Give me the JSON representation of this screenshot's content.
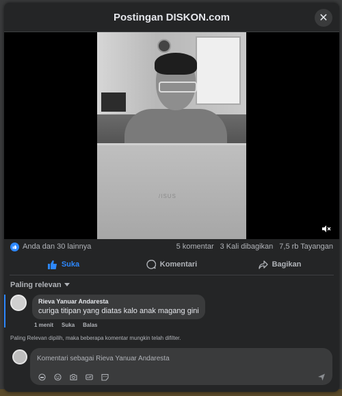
{
  "dialog": {
    "title": "Postingan DISKON.com",
    "close_symbol": "✕"
  },
  "video": {
    "laptop_logo": "/ISUS",
    "mute_icon": "volume-muted-icon"
  },
  "stats": {
    "reactions": "Anda dan 30 lainnya",
    "comments": "5 komentar",
    "shares": "3 Kali dibagikan",
    "views": "7,5 rb Tayangan"
  },
  "actions": {
    "like": "Suka",
    "comment": "Komentari",
    "share": "Bagikan"
  },
  "sort": {
    "label": "Paling relevan"
  },
  "comments": [
    {
      "author": "Rieva Yanuar Andaresta",
      "text": "curiga titipan yang diatas kalo anak magang gini",
      "time": "1 menit",
      "like": "Suka",
      "reply": "Balas"
    }
  ],
  "filter_note": "Paling Relevan dipilih, maka beberapa komentar mungkin telah difilter.",
  "composer": {
    "placeholder": "Komentari sebagai Rieva Yanuar Andaresta"
  },
  "colors": {
    "accent": "#2d88ff",
    "surface": "#242526",
    "bubble": "#3a3b3c"
  }
}
